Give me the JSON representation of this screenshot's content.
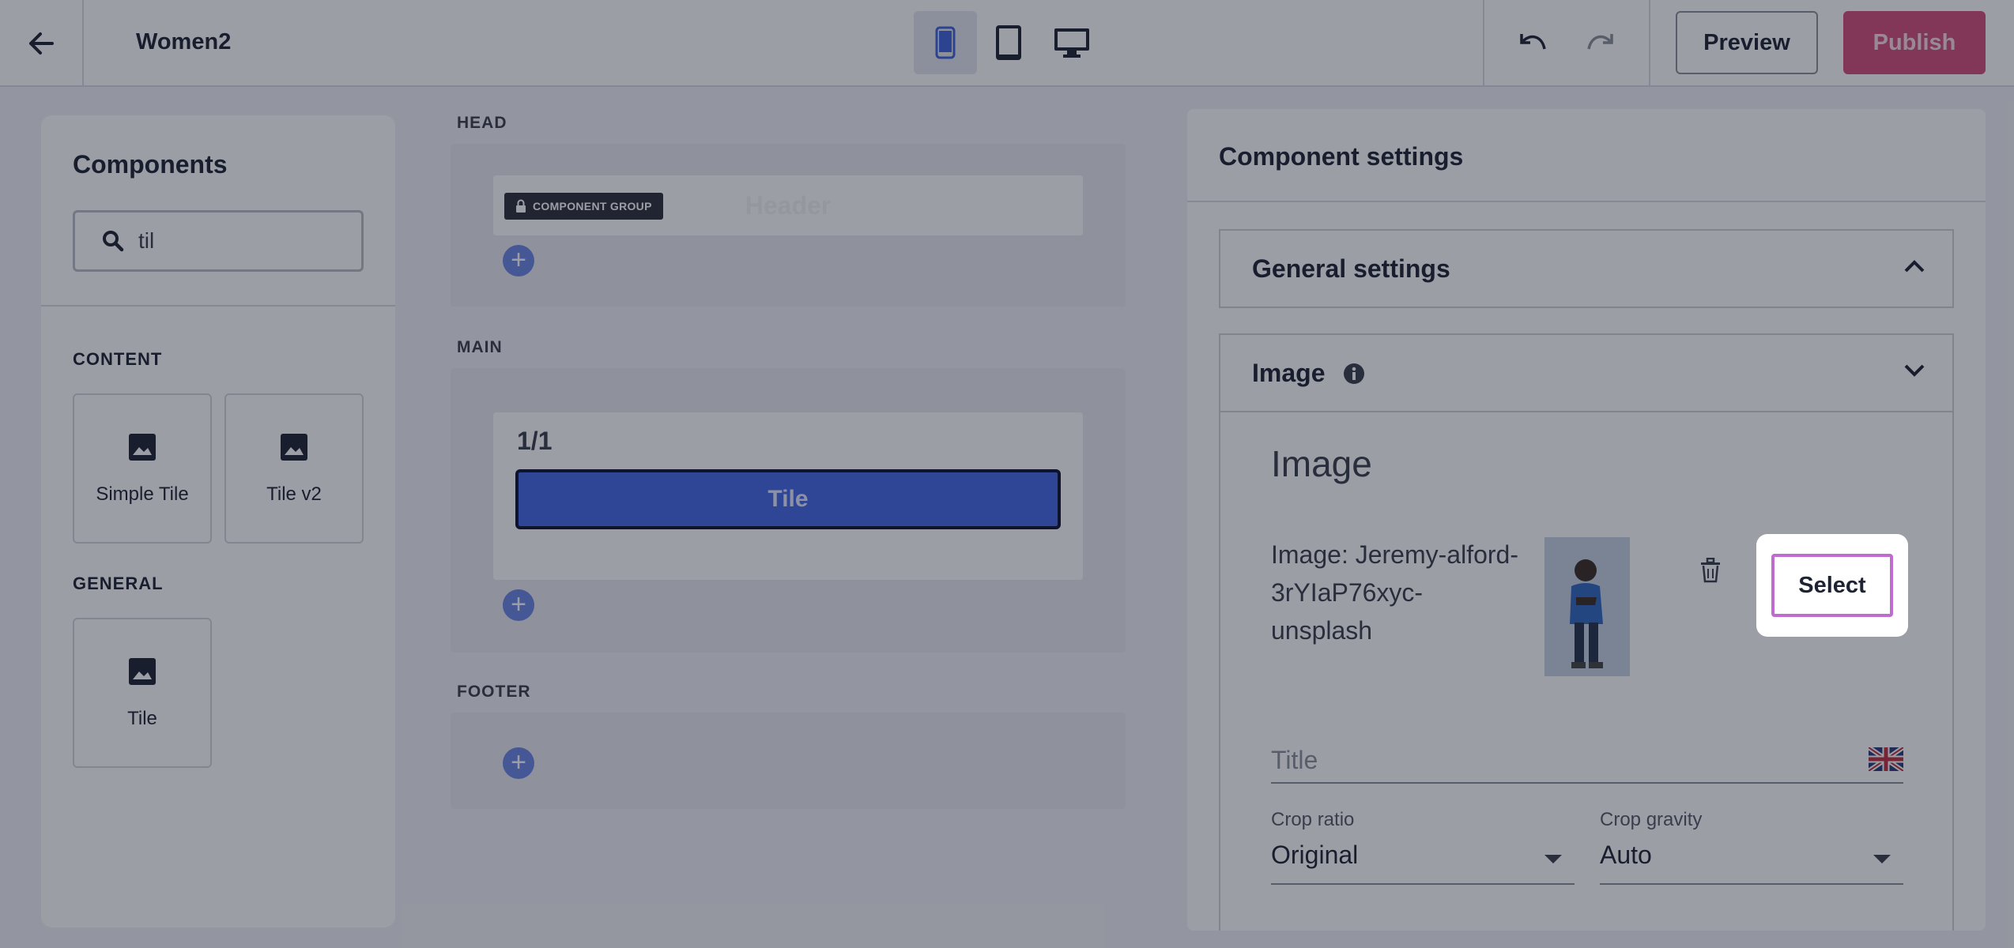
{
  "topbar": {
    "page_name": "Women2",
    "preview_label": "Preview",
    "publish_label": "Publish",
    "publish_color": "#d24c7a"
  },
  "components_panel": {
    "title": "Components",
    "search_value": "til",
    "sections": [
      {
        "label": "CONTENT",
        "items": [
          "Simple Tile",
          "Tile v2"
        ]
      },
      {
        "label": "GENERAL",
        "items": [
          "Tile"
        ]
      }
    ]
  },
  "canvas": {
    "head_label": "HEAD",
    "main_label": "MAIN",
    "footer_label": "FOOTER",
    "component_group_label": "COMPONENT GROUP",
    "header_component": "Header",
    "column_label": "1/1",
    "tile_component": "Tile",
    "accent_color": "#4466e3"
  },
  "settings": {
    "title": "Component settings",
    "general_settings_label": "General settings",
    "image_section_label": "Image",
    "image_heading": "Image",
    "image_name": "Image: Jeremy-alford-3rYIaP76xyc-unsplash",
    "select_label": "Select",
    "title_placeholder": "Title",
    "crop_ratio_label": "Crop ratio",
    "crop_ratio_value": "Original",
    "crop_gravity_label": "Crop gravity",
    "crop_gravity_value": "Auto"
  },
  "icons": [
    "back-arrow-icon",
    "mobile-icon",
    "tablet-icon",
    "desktop-icon",
    "undo-icon",
    "redo-icon",
    "search-icon",
    "image-icon",
    "lock-icon",
    "plus-icon",
    "info-icon",
    "chevron-up-icon",
    "chevron-down-icon",
    "trash-icon",
    "uk-flag-icon"
  ]
}
